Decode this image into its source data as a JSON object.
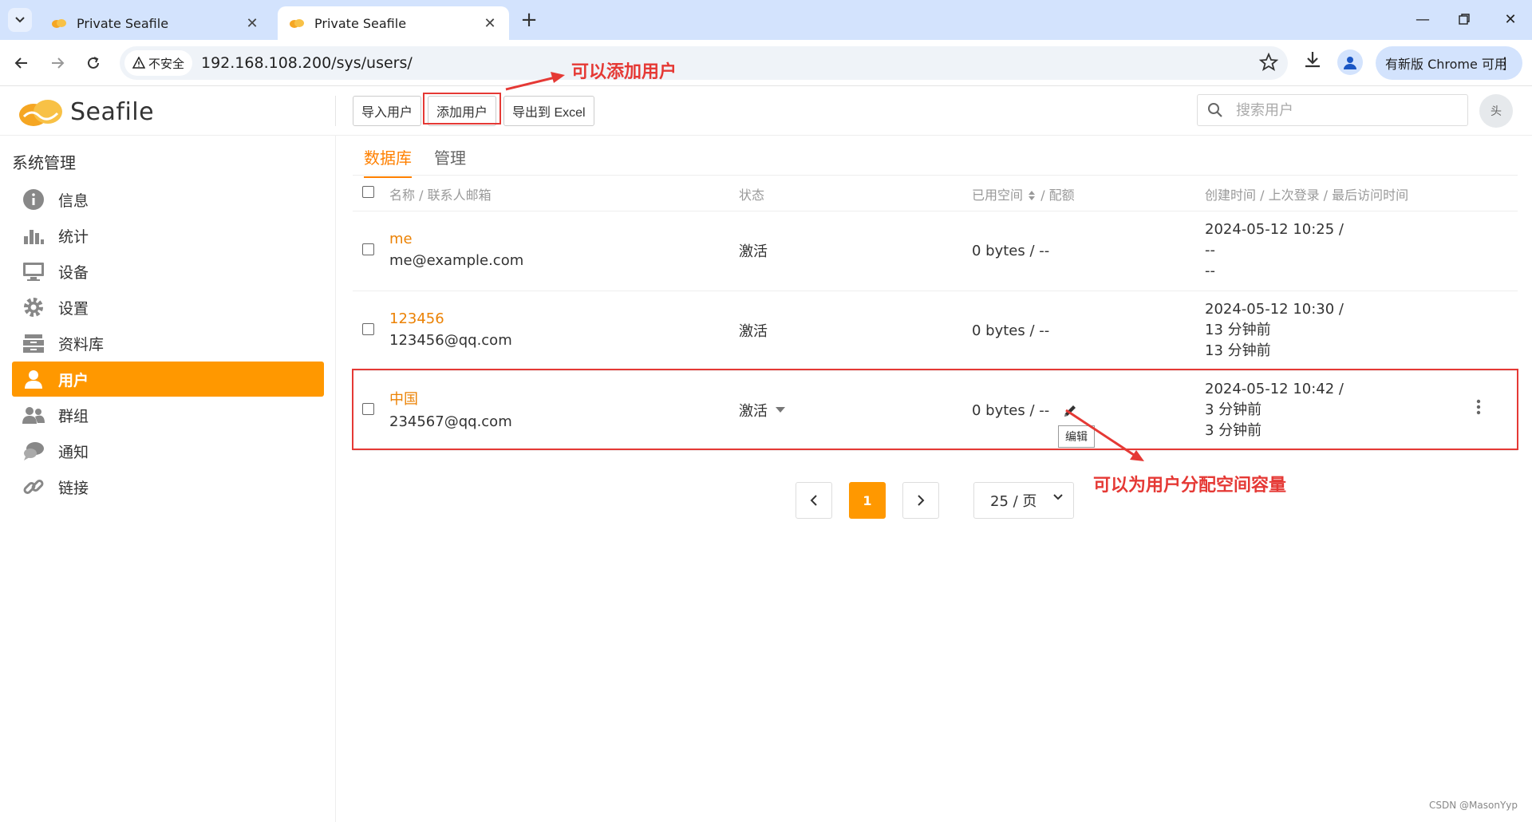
{
  "browser": {
    "tabs": [
      {
        "title": "Private Seafile",
        "active": false
      },
      {
        "title": "Private Seafile",
        "active": true
      }
    ],
    "security_label": "不安全",
    "url": "192.168.108.200/sys/users/",
    "update_label": "有新版 Chrome 可用"
  },
  "app": {
    "logo_text": "Seafile",
    "toolbar": {
      "import_label": "导入用户",
      "add_label": "添加用户",
      "export_label": "导出到 Excel"
    },
    "search_placeholder": "搜索用户",
    "avatar_alt": "头"
  },
  "sidebar": {
    "heading": "系统管理",
    "items": [
      {
        "label": "信息",
        "icon": "info-icon",
        "active": false
      },
      {
        "label": "统计",
        "icon": "bar-chart-icon",
        "active": false
      },
      {
        "label": "设备",
        "icon": "monitor-icon",
        "active": false
      },
      {
        "label": "设置",
        "icon": "gear-icon",
        "active": false
      },
      {
        "label": "资料库",
        "icon": "archive-icon",
        "active": false
      },
      {
        "label": "用户",
        "icon": "user-icon",
        "active": true
      },
      {
        "label": "群组",
        "icon": "group-icon",
        "active": false
      },
      {
        "label": "通知",
        "icon": "chat-icon",
        "active": false
      },
      {
        "label": "链接",
        "icon": "link-icon",
        "active": false
      }
    ]
  },
  "main": {
    "tabs": [
      {
        "label": "数据库",
        "active": true
      },
      {
        "label": "管理",
        "active": false
      }
    ],
    "table": {
      "headers": {
        "name": "名称 / 联系人邮箱",
        "status": "状态",
        "space": "已用空间",
        "quota": "/ 配额",
        "time": "创建时间 / 上次登录 / 最后访问时间"
      },
      "rows": [
        {
          "name": "me",
          "email": "me@example.com",
          "status": "激活",
          "space": "0 bytes / --",
          "created": "2024-05-12 10:25 /",
          "last_login": "--",
          "last_access": "--"
        },
        {
          "name": "123456",
          "email": "123456@qq.com",
          "status": "激活",
          "space": "0 bytes / --",
          "created": "2024-05-12 10:30 /",
          "last_login": "13 分钟前",
          "last_access": "13 分钟前"
        },
        {
          "name": "中国",
          "email": "234567@qq.com",
          "status": "激活",
          "space": "0 bytes / --",
          "created": "2024-05-12 10:42 /",
          "last_login": "3 分钟前",
          "last_access": "3 分钟前"
        }
      ]
    },
    "edit_tooltip": "编辑",
    "pagination": {
      "current": "1",
      "per_page": "25 / 页"
    }
  },
  "annotations": {
    "add_user_note": "可以添加用户",
    "quota_note": "可以为用户分配空间容量"
  },
  "watermark": "CSDN @MasonYyp",
  "colors": {
    "accent": "#ff9800",
    "link": "#eb8205",
    "annotation": "#e53935"
  }
}
